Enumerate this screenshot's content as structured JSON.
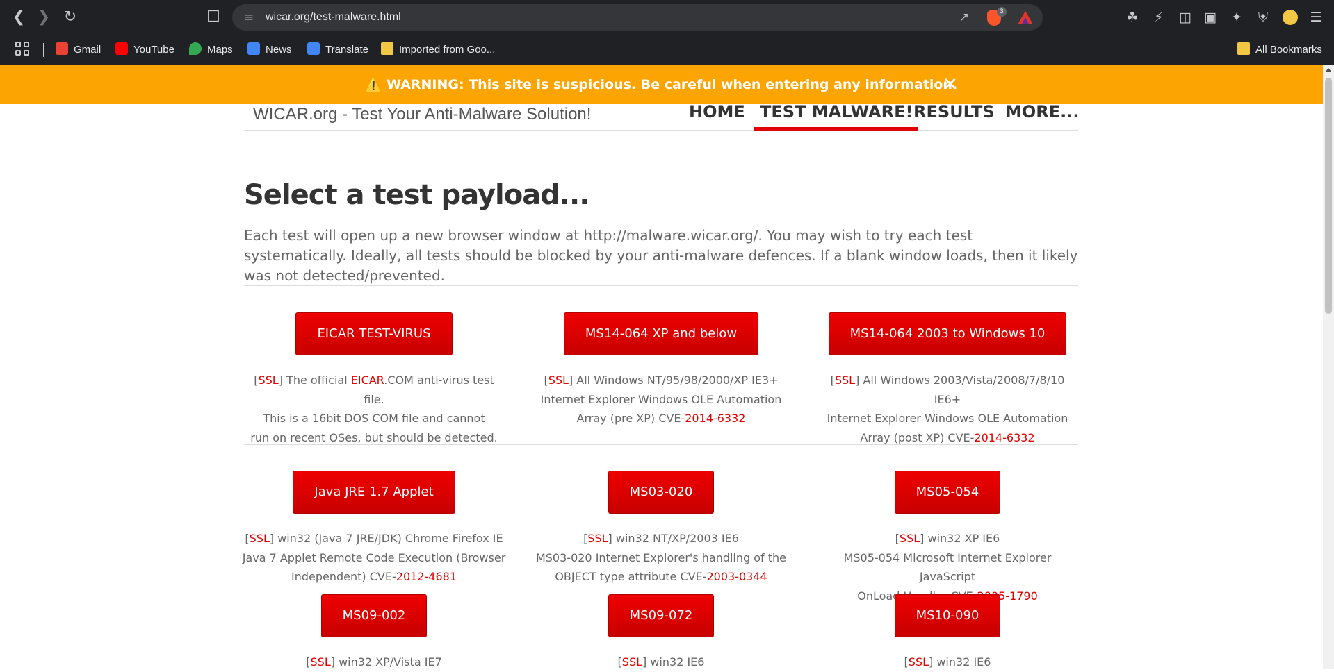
{
  "browser": {
    "url": "wicar.org/test-malware.html",
    "brave_badge_count": "3",
    "bookmarks": [
      {
        "label": "Gmail",
        "color": "#ea4335"
      },
      {
        "label": "YouTube",
        "color": "#ff0000"
      },
      {
        "label": "Maps",
        "color": "#34a853"
      },
      {
        "label": "News",
        "color": "#4285f4"
      },
      {
        "label": "Translate",
        "color": "#4285f4"
      },
      {
        "label": "Imported from Goo...",
        "color": "#f2c744"
      }
    ],
    "all_bookmarks": "All Bookmarks"
  },
  "warning": {
    "text": "⚠️ WARNING: This site is suspicious. Be careful when entering any information.",
    "close": "✕",
    "background": "#fba402"
  },
  "site": {
    "title": "WICAR.org - Test Your Anti-Malware Solution!",
    "nav": [
      "HOME",
      "TEST MALWARE!",
      "RESULTS",
      "MORE..."
    ]
  },
  "page": {
    "heading": "Select a test payload...",
    "intro": "Each test will open up a new browser window at http://malware.wicar.org/. You may wish to try each test systematically. Ideally, all tests should be blocked by your anti-malware defences. If a blank window loads, then it likely was not detected/prevented."
  },
  "tests": [
    {
      "button": "EICAR TEST-VIRUS",
      "ssl": "SSL",
      "line1a": "] The official ",
      "line1b": "EICAR",
      "line1c": ".COM anti-virus test file.",
      "line2": "This is a 16bit DOS COM file and cannot",
      "line3": "run on recent OSes, but should be detected."
    },
    {
      "button": "MS14-064 XP and below",
      "ssl": "SSL",
      "line1": "] All Windows NT/95/98/2000/XP IE3+",
      "line2": "Internet Explorer Windows OLE Automation",
      "line3": "Array (pre  XP) CVE-",
      "cve": "2014-6332"
    },
    {
      "button": "MS14-064 2003 to Windows 10",
      "ssl": "SSL",
      "line1": "] All Windows 2003/Vista/2008/7/8/10 IE6+",
      "line2": "Internet Explorer Windows OLE Automation",
      "line3": "Array (post XP) CVE-",
      "cve": "2014-6332"
    },
    {
      "button": "Java JRE 1.7 Applet",
      "ssl": "SSL",
      "line1": "] win32 (Java 7 JRE/JDK) Chrome Firefox IE",
      "line2": "Java 7 Applet Remote Code Execution (Browser",
      "line3": "Independent) CVE-",
      "cve": "2012-4681"
    },
    {
      "button": "MS03-020",
      "ssl": "SSL",
      "line1": "] win32 NT/XP/2003 IE6",
      "line2": "MS03-020 Internet Explorer's handling of the",
      "line3": "OBJECT type attribute CVE-",
      "cve": "2003-0344"
    },
    {
      "button": "MS05-054",
      "ssl": "SSL",
      "line1": "] win32 XP IE6",
      "line2": "MS05-054 Microsoft Internet Explorer JavaScript",
      "line3": "OnLoad Handler CVE-",
      "cve": "2005-1790"
    },
    {
      "button": "MS09-002",
      "ssl": "SSL",
      "line1": "] win32 XP/Vista IE7"
    },
    {
      "button": "MS09-072",
      "ssl": "SSL",
      "line1": "] win32 IE6"
    },
    {
      "button": "MS10-090",
      "ssl": "SSL",
      "line1": "] win32 IE6"
    }
  ]
}
